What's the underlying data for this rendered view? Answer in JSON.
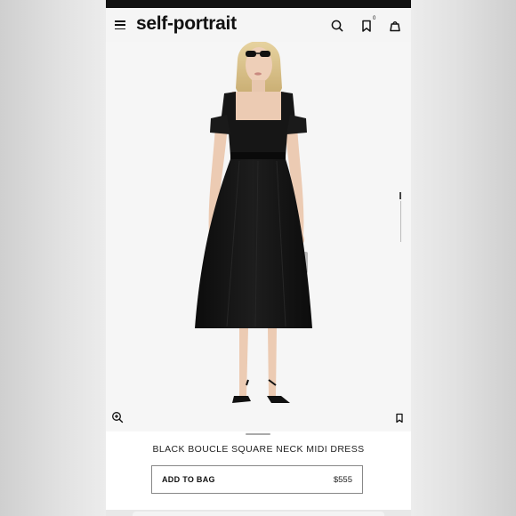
{
  "header": {
    "brand": "self-portrait",
    "wishlist_count": "0",
    "icons": [
      "menu-icon",
      "search-icon",
      "wishlist-icon",
      "bag-icon"
    ]
  },
  "product": {
    "name": "BLACK BOUCLE SQUARE NECK MIDI DRESS",
    "price": "$555",
    "add_to_bag_label": "ADD TO BAG",
    "gallery": {
      "current_index": 1,
      "icons": [
        "zoom-in-icon",
        "save-icon"
      ]
    }
  },
  "colors": {
    "text": "#111111",
    "dress": "#141414",
    "background": "#f6f6f6"
  }
}
